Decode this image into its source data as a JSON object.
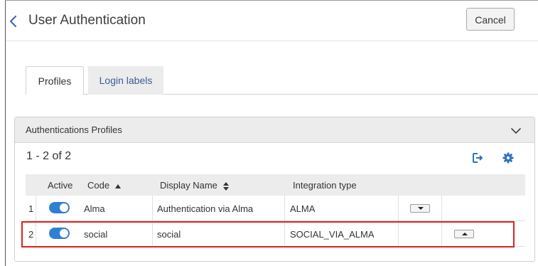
{
  "header": {
    "title": "User Authentication",
    "cancel_label": "Cancel",
    "back_icon": "chevron-left-icon"
  },
  "tabs": [
    {
      "label": "Profiles",
      "active": true
    },
    {
      "label": "Login labels",
      "active": false
    }
  ],
  "panel": {
    "title": "Authentications Profiles",
    "pager": "1 - 2 of 2",
    "icons": [
      "collapse-chevron-icon",
      "export-icon",
      "settings-gear-icon"
    ]
  },
  "table": {
    "columns": [
      "",
      "Active",
      "Code",
      "Display Name",
      "Integration type",
      "",
      ""
    ],
    "rows": [
      {
        "num": "1",
        "active": true,
        "code": "Alma",
        "display_name": "Authentication via Alma",
        "integration_type": "ALMA",
        "order_button": "move-down"
      },
      {
        "num": "2",
        "active": true,
        "code": "social",
        "display_name": "social",
        "integration_type": "SOCIAL_VIA_ALMA",
        "order_button": "move-up"
      }
    ]
  },
  "colors": {
    "toggle_on": "#2f7fd4",
    "highlight": "#e02020",
    "link": "#3a5b99",
    "panel_header": "#ececec"
  }
}
